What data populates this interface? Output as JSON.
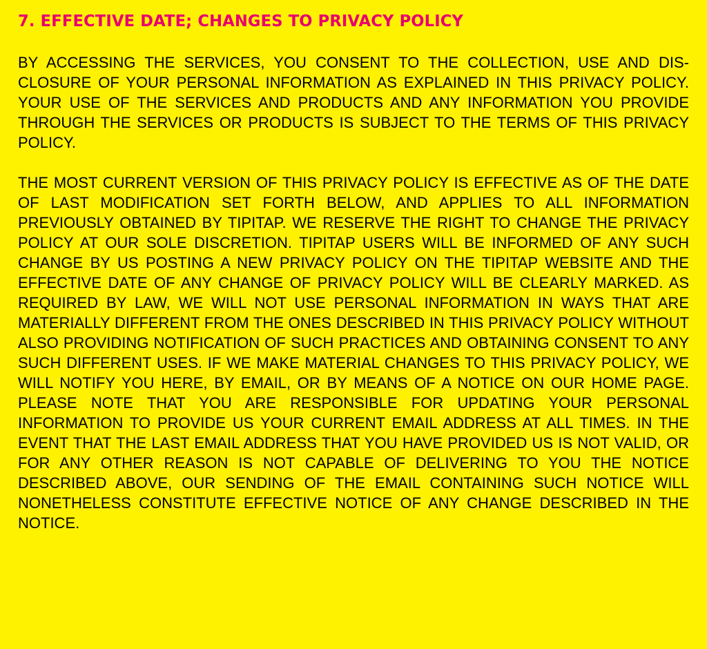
{
  "section": {
    "title": "7. EFFECTIVE DATE; CHANGES TO PRIVACY POLICY",
    "paragraphs": [
      "BY ACCESSING THE SERVICES, YOU CONSENT TO THE COLLECTION, USE AND DIS­CLOSURE OF YOUR PERSONAL INFORMATION AS EXPLAINED IN THIS PRIVACY POLICY. YOUR USE OF THE SERVICES AND PRODUCTS AND ANY INFORMATION YOU PROVIDE THROUGH THE SERVICES OR PRODUCTS IS SUBJECT TO THE TERMS OF THIS PRIVACY POLICY.",
      "THE MOST CURRENT VERSION OF THIS PRIVACY POLICY IS EFFECTIVE AS OF THE DATE OF LAST MODIFICATION SET FORTH BELOW, AND APPLIES TO ALL INFORMA­TION PREVIOUSLY OBTAINED BY TIPITAP. WE RESERVE THE RIGHT TO CHANGE THE PRIVACY POLICY AT OUR SOLE DISCRETION. TIPITAP USERS WILL BE INFORMED OF ANY SUCH CHANGE BY US POSTING A NEW PRIVACY POLICY ON THE TIPITAP WEB­SITE AND THE EFFECTIVE DATE OF ANY CHANGE OF PRIVACY POLICY WILL BE CLEARLY MARKED. AS REQUIRED BY LAW, WE WILL NOT USE PERSONAL INFORMA­TION IN WAYS THAT ARE MATERIALLY DIFFERENT FROM THE ONES DESCRIBED IN THIS PRIVACY POLICY WITHOUT ALSO PROVIDING NOTIFICATION OF SUCH PRAC­TICES AND OBTAINING CONSENT TO ANY SUCH DIFFERENT USES. IF WE MAKE MA­TERIAL CHANGES TO THIS PRIVACY POLICY, WE WILL NOTIFY YOU HERE, BY EMAIL, OR BY MEANS OF A NOTICE ON OUR HOME PAGE. PLEASE NOTE THAT YOU ARE RE­SPONSIBLE FOR UPDATING YOUR PERSONAL INFORMATION TO PROVIDE US YOUR CURRENT EMAIL ADDRESS AT ALL TIMES. IN THE EVENT THAT THE LAST EMAIL AD­DRESS THAT YOU HAVE PROVIDED US IS NOT VALID, OR FOR ANY OTHER REASON IS NOT CAPABLE OF DELIVERING TO YOU THE NOTICE DESCRIBED ABOVE, OUR SENDING OF THE EMAIL CONTAINING SUCH NOTICE WILL NONETHELESS CONSTI­TUTE EFFECTIVE NOTICE OF ANY CHANGE DESCRIBED IN THE NOTICE."
    ]
  },
  "colors": {
    "background": "#FFF200",
    "title": "#E8006F",
    "body_text": "#000000"
  }
}
